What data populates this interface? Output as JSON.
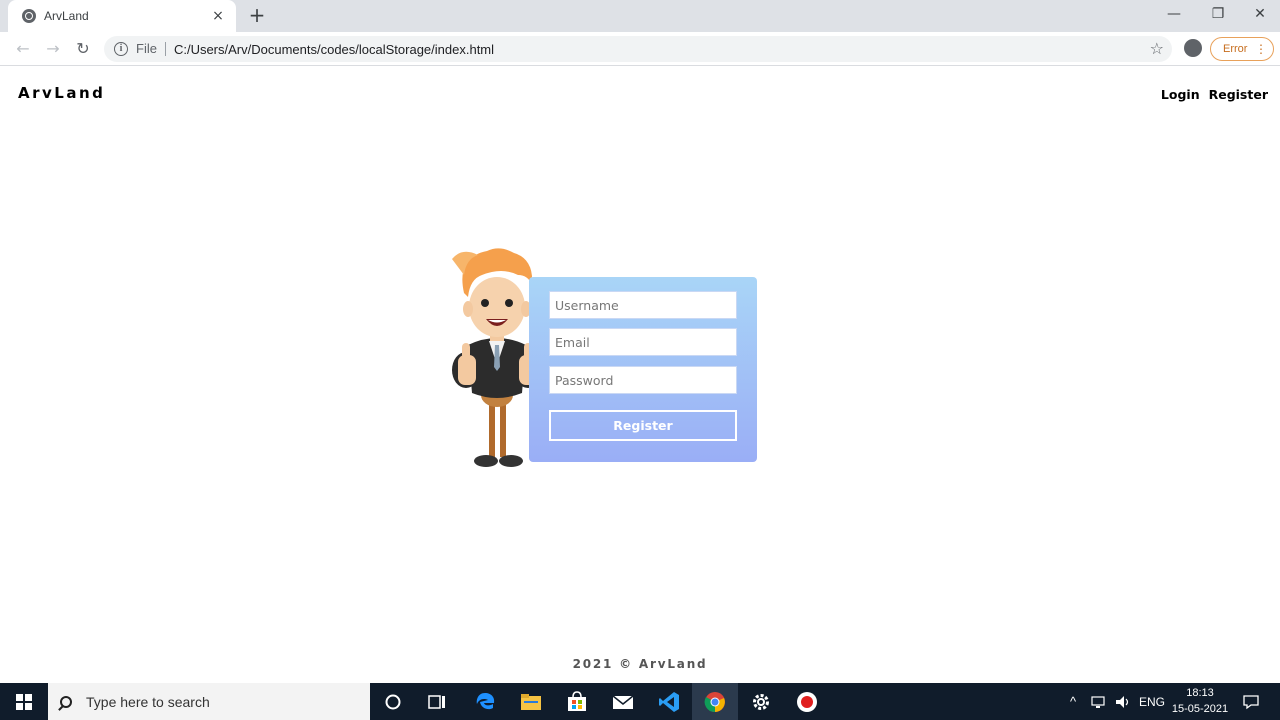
{
  "browser": {
    "tab_title": "ArvLand",
    "tab_close": "×",
    "new_tab": "+",
    "window_controls": {
      "minimize": "—",
      "restore": "❐",
      "close": "✕"
    },
    "nav": {
      "back": "←",
      "forward": "→",
      "reload": "↻"
    },
    "address": {
      "info": "i",
      "scheme": "File",
      "url": "C:/Users/Arv/Documents/codes/localStorage/index.html",
      "star": "☆"
    },
    "error_label": "Error",
    "menu_dots": "⋮"
  },
  "page": {
    "brand": "ArvLand",
    "nav": {
      "login": "Login",
      "register": "Register"
    },
    "form": {
      "username_placeholder": "Username",
      "email_placeholder": "Email",
      "password_placeholder": "Password",
      "submit_label": "Register"
    },
    "footer": "2021 © ArvLand"
  },
  "taskbar": {
    "search_placeholder": "Type here to search",
    "language": "ENG",
    "time": "18:13",
    "date": "15-05-2021",
    "tray_arrow": "^"
  },
  "colors": {
    "card_top": "#a9d5f7",
    "card_bottom": "#9aaef6",
    "taskbar": "#101c2b"
  }
}
